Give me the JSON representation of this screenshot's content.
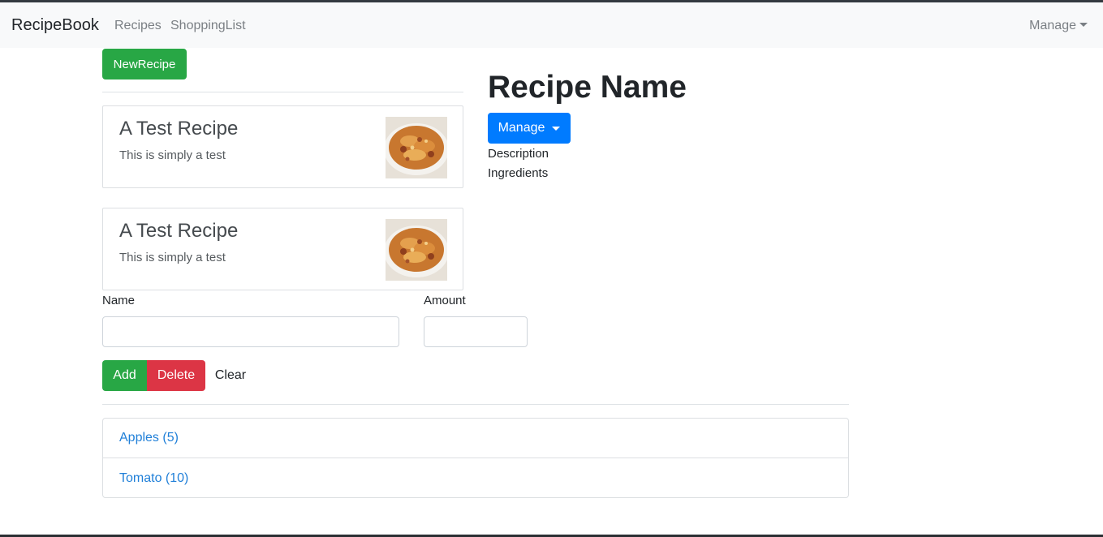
{
  "navbar": {
    "brand": "RecipeBook",
    "links": [
      "Recipes",
      "ShoppingList"
    ],
    "manage": "Manage"
  },
  "recipe_list": {
    "new_button": "NewRecipe",
    "items": [
      {
        "title": "A Test Recipe",
        "description": "This is simply a test",
        "image": "pasta-dish-image"
      },
      {
        "title": "A Test Recipe",
        "description": "This is simply a test",
        "image": "pasta-dish-image"
      }
    ]
  },
  "recipe_detail": {
    "title": "Recipe Name",
    "manage_button": "Manage",
    "description": "Description",
    "ingredients": "Ingredients"
  },
  "shopping_form": {
    "name_label": "Name",
    "amount_label": "Amount",
    "name_value": "",
    "amount_value": "",
    "add_label": "Add",
    "delete_label": "Delete",
    "clear_label": "Clear"
  },
  "shopping_list": {
    "items": [
      "Apples (5)",
      "Tomato (10)"
    ]
  },
  "colors": {
    "success": "#28a745",
    "danger": "#dc3545",
    "primary": "#007bff",
    "link": "#1f7fd8",
    "navbar_bg": "#f8f9fa"
  }
}
